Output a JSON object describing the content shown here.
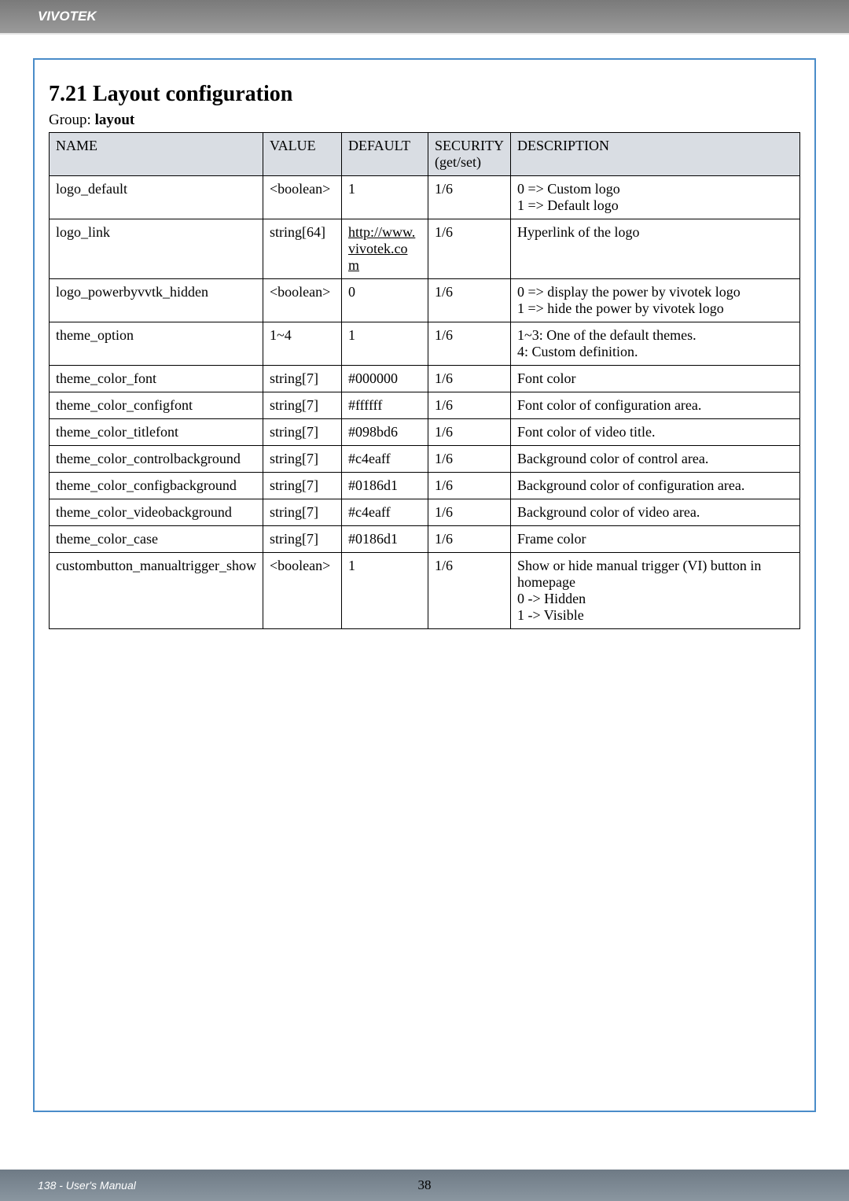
{
  "header": {
    "brand": "VIVOTEK"
  },
  "section": {
    "title": "7.21 Layout configuration",
    "group_prefix": "Group: ",
    "group_name": "layout"
  },
  "table": {
    "headers": {
      "name": "NAME",
      "value": "VALUE",
      "default": "DEFAULT",
      "security": "SECURITY",
      "security_sub": "(get/set)",
      "description": "DESCRIPTION"
    },
    "rows": [
      {
        "name": "logo_default",
        "value": "<boolean>",
        "default": "1",
        "security": "1/6",
        "description": "0 => Custom logo\n1 => Default logo"
      },
      {
        "name": "logo_link",
        "value": "string[64]",
        "default_link": "http://www.vivotek.com",
        "security": "1/6",
        "description": "Hyperlink of the logo"
      },
      {
        "name": "logo_powerbyvvtk_hidden",
        "value": "<boolean>",
        "default": "0",
        "security": "1/6",
        "description": "0 => display the power by vivotek logo\n1 => hide the power by vivotek logo"
      },
      {
        "name": "theme_option",
        "value": "1~4",
        "default": "1",
        "security": "1/6",
        "description": "1~3: One of the default themes.\n4: Custom definition."
      },
      {
        "name": "theme_color_font",
        "value": "string[7]",
        "default": "#000000",
        "security": "1/6",
        "description": "Font color"
      },
      {
        "name": "theme_color_configfont",
        "value": "string[7]",
        "default": "#ffffff",
        "security": "1/6",
        "description": "Font color of configuration area."
      },
      {
        "name": "theme_color_titlefont",
        "value": "string[7]",
        "default": "#098bd6",
        "security": "1/6",
        "description": "Font color of video title."
      },
      {
        "name": "theme_color_controlbackground",
        "value": "string[7]",
        "default": "#c4eaff",
        "security": "1/6",
        "description": "Background color of control area."
      },
      {
        "name": "theme_color_configbackground",
        "value": "string[7]",
        "default": "#0186d1",
        "security": "1/6",
        "description": "Background color of configuration area."
      },
      {
        "name": "theme_color_videobackground",
        "value": "string[7]",
        "default": "#c4eaff",
        "security": "1/6",
        "description": "Background color of video area."
      },
      {
        "name": "theme_color_case",
        "value": "string[7]",
        "default": "#0186d1",
        "security": "1/6",
        "description": "Frame color"
      },
      {
        "name": "custombutton_manualtrigger_show",
        "value": "<boolean>",
        "default": "1",
        "security": "1/6",
        "description": "Show or hide manual trigger (VI) button in homepage\n0 -> Hidden\n1 -> Visible"
      }
    ]
  },
  "footer": {
    "left": "138 - User's Manual",
    "page_num": "38"
  }
}
